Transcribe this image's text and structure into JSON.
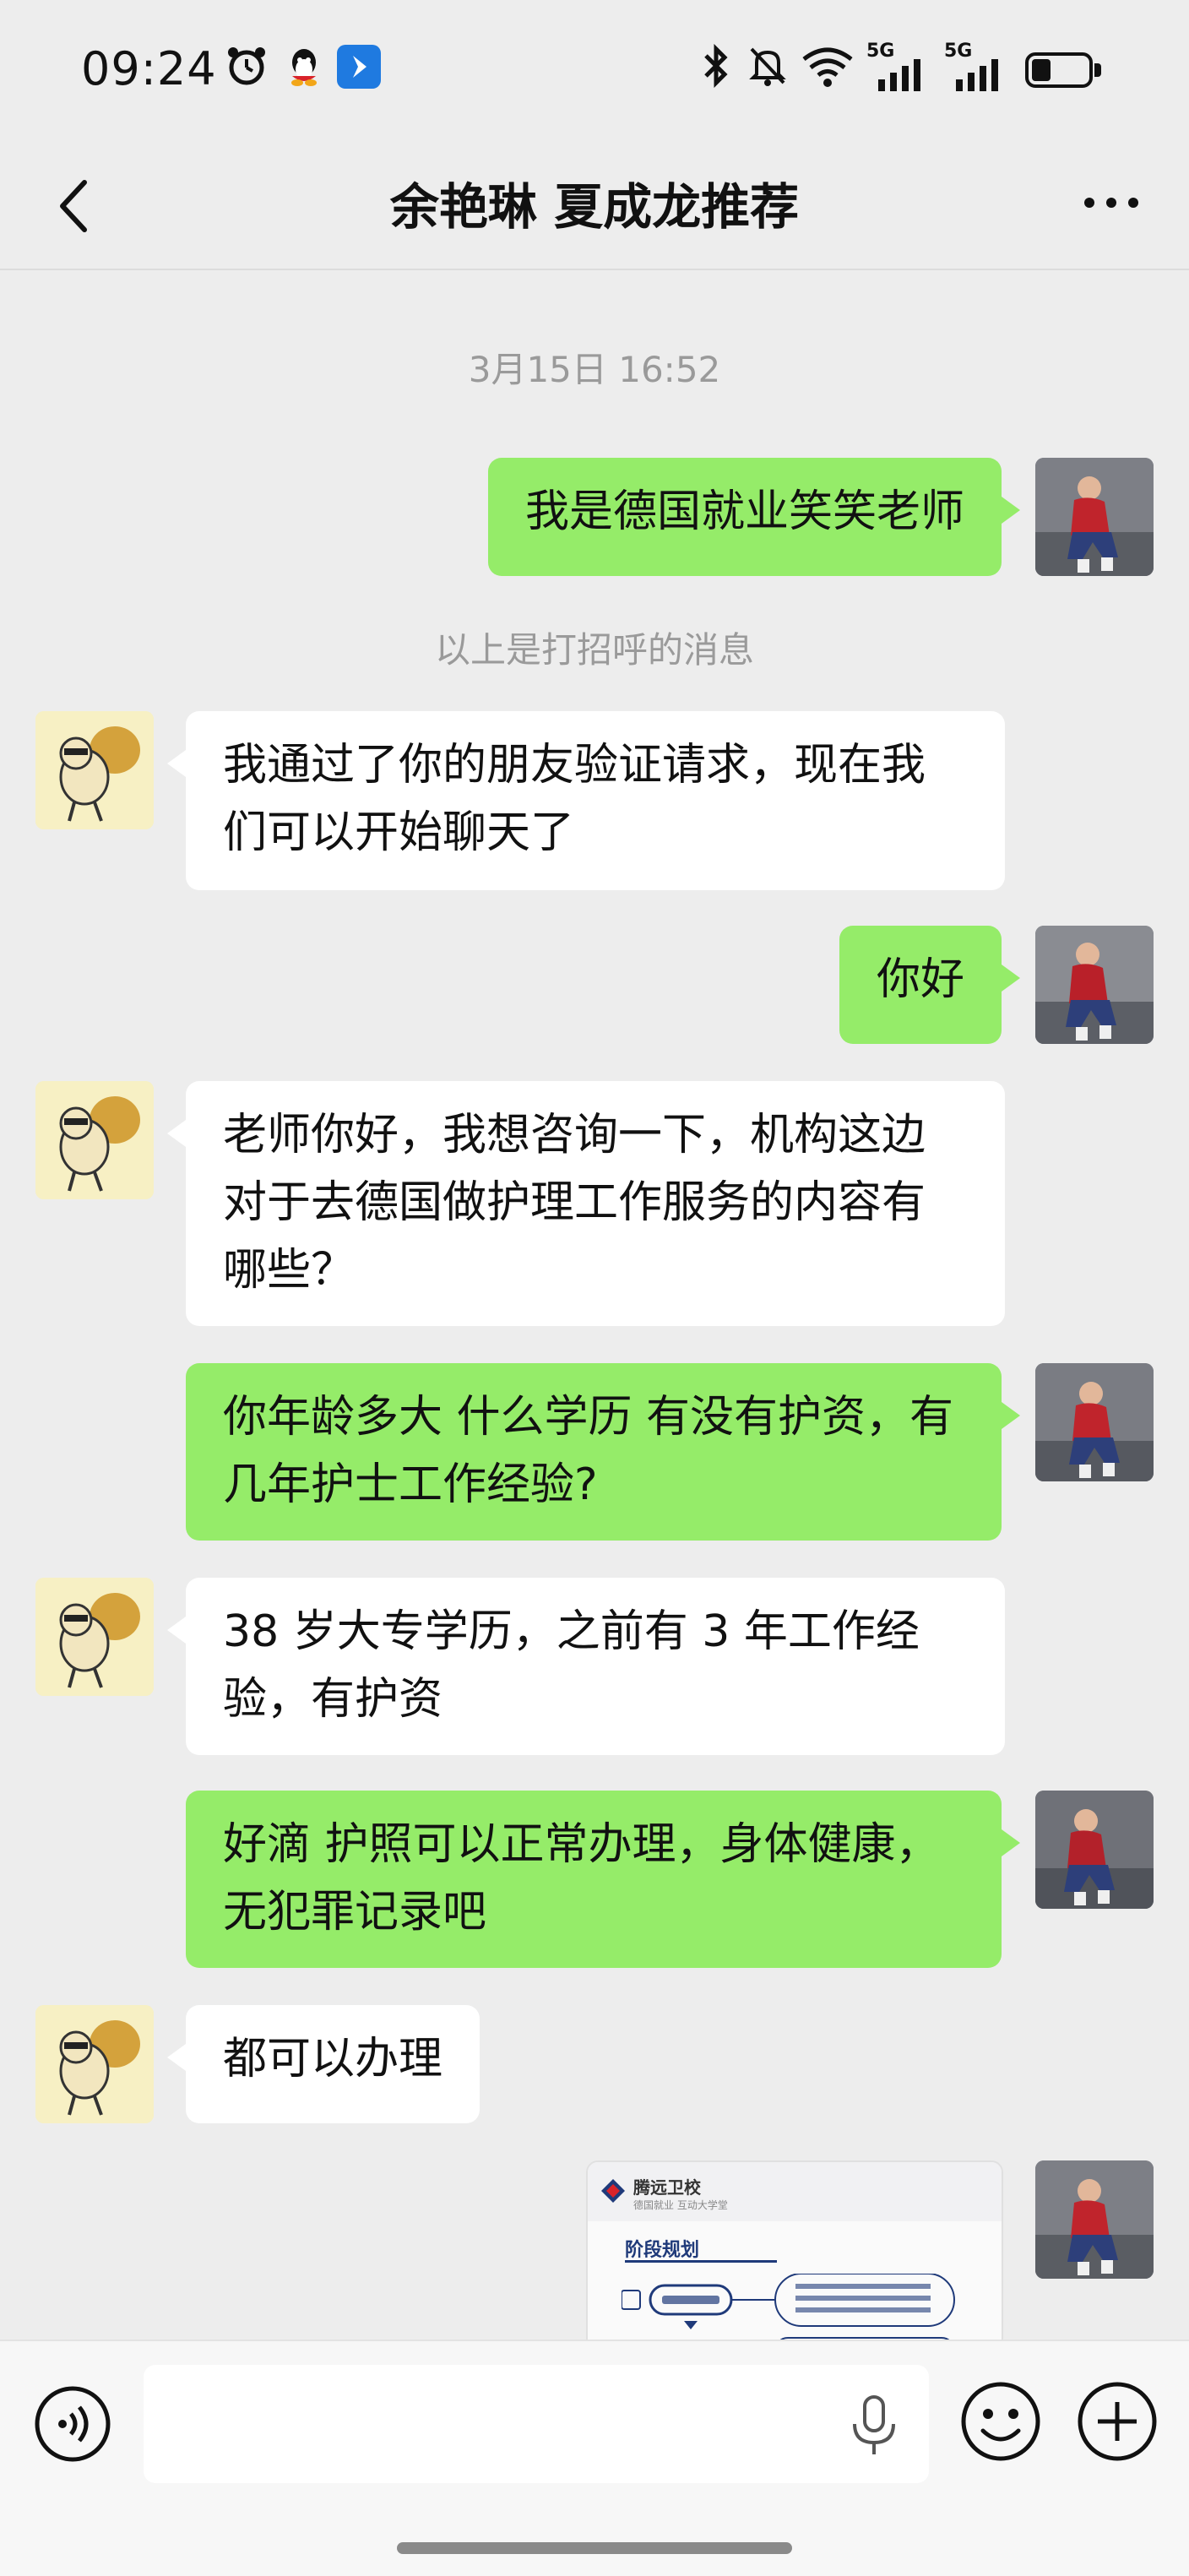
{
  "status_bar": {
    "time": "09:24",
    "left_icons": [
      "alarm-icon",
      "qq-icon",
      "app-icon"
    ],
    "right_icons": [
      "bluetooth-icon",
      "mute-bell-icon",
      "wifi-icon",
      "signal-5g-icon",
      "signal-5g-icon",
      "battery-icon"
    ],
    "network_label_1": "5G",
    "network_label_2": "5G"
  },
  "header": {
    "title": "余艳琳 夏成龙推荐",
    "back_icon": "back-chevron-icon",
    "more_icon": "more-dots-icon"
  },
  "chat": {
    "timestamp": "3月15日 16:52",
    "system_notice": "以上是打招呼的消息",
    "messages": [
      {
        "side": "out",
        "text": "我是德国就业笑笑老师"
      },
      {
        "side": "in",
        "text": "我通过了你的朋友验证请求，现在我们可以开始聊天了"
      },
      {
        "side": "out",
        "text": "你好"
      },
      {
        "side": "in",
        "text": "老师你好，我想咨询一下，机构这边对于去德国做护理工作服务的内容有哪些？"
      },
      {
        "side": "out",
        "text": "你年龄多大  什么学历   有没有护资，有几年护士工作经验?"
      },
      {
        "side": "in",
        "text": "38 岁大专学历，之前有 3 年工作经验，有护资"
      },
      {
        "side": "out",
        "text": "好滴  护照可以正常办理，身体健康，无犯罪记录吧"
      },
      {
        "side": "in",
        "text": "都可以办理"
      }
    ],
    "image_card": {
      "brand": "腾远卫校",
      "subbrand": "德国就业 互动大学堂",
      "title": "阶段规划"
    }
  },
  "input_bar": {
    "voice_icon": "voice-icon",
    "mic_icon": "microphone-icon",
    "emoji_icon": "emoji-icon",
    "plus_icon": "plus-icon"
  },
  "colors": {
    "background": "#ededed",
    "outgoing_bubble": "#95ec69",
    "incoming_bubble": "#ffffff",
    "system_text": "#9a9a9a"
  }
}
